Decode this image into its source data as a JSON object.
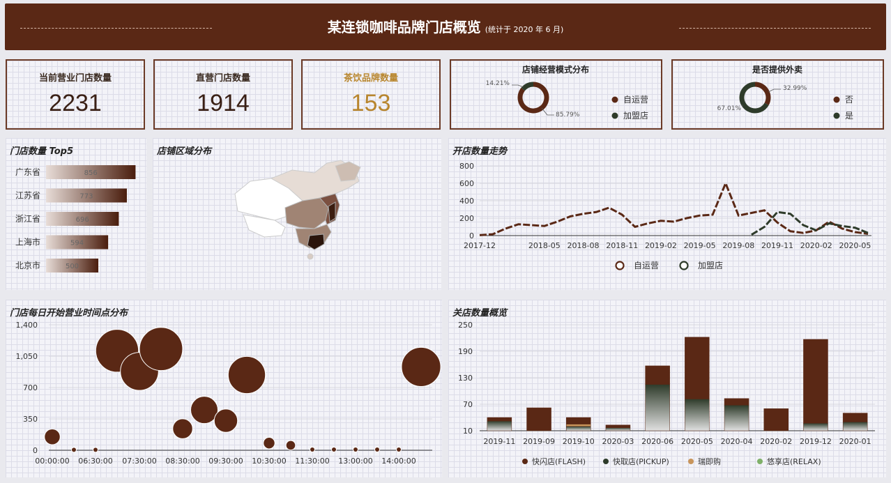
{
  "header": {
    "title": "某连锁咖啡品牌门店概览",
    "subtitle": "(统计于 2020 年 6 月)"
  },
  "kpis": [
    {
      "label": "当前营业门店数量",
      "value": "2231",
      "color": "#3a2015"
    },
    {
      "label": "直营门店数量",
      "value": "1914",
      "color": "#3a2015"
    },
    {
      "label": "茶饮品牌数量",
      "value": "153",
      "color": "#b8862e"
    }
  ],
  "colors": {
    "brown": "#5a2815",
    "green": "#2e3b2a",
    "tan": "#c8955c",
    "lightgreen": "#7fb069"
  },
  "chart_data": [
    {
      "type": "pie",
      "title": "店铺经营模式分布",
      "slices": [
        {
          "name": "自运营",
          "value": 85.79,
          "label": "85.79%"
        },
        {
          "name": "加盟店",
          "value": 14.21,
          "label": "14.21%"
        }
      ]
    },
    {
      "type": "pie",
      "title": "是否提供外卖",
      "slices": [
        {
          "name": "否",
          "value": 32.99,
          "label": "32.99%"
        },
        {
          "name": "是",
          "value": 67.01,
          "label": "67.01%"
        }
      ]
    },
    {
      "type": "bar",
      "title": "门店数量 Top5",
      "categories": [
        "广东省",
        "江苏省",
        "浙江省",
        "上海市",
        "北京市"
      ],
      "values": [
        856,
        773,
        696,
        594,
        500
      ],
      "xlim": [
        0,
        900
      ]
    },
    {
      "type": "map",
      "title": "店铺区域分布"
    },
    {
      "type": "line",
      "title": "开店数量走势",
      "x": [
        "2017-12",
        "2018-01",
        "2018-02",
        "2018-03",
        "2018-04",
        "2018-05",
        "2018-06",
        "2018-07",
        "2018-08",
        "2018-09",
        "2018-10",
        "2018-11",
        "2018-12",
        "2019-01",
        "2019-02",
        "2019-03",
        "2019-04",
        "2019-05",
        "2019-06",
        "2019-07",
        "2019-08",
        "2019-09",
        "2019-10",
        "2019-11",
        "2019-12",
        "2020-01",
        "2020-02",
        "2020-03",
        "2020-04",
        "2020-05",
        "2020-06"
      ],
      "xticks": [
        "2017-12",
        "2018-05",
        "2018-08",
        "2018-11",
        "2019-02",
        "2019-05",
        "2019-08",
        "2019-11",
        "2020-02",
        "2020-05"
      ],
      "ylim": [
        0,
        800
      ],
      "yticks": [
        0,
        200,
        400,
        600,
        800
      ],
      "series": [
        {
          "name": "自运营",
          "values": [
            5,
            15,
            80,
            130,
            120,
            110,
            160,
            220,
            250,
            270,
            320,
            240,
            100,
            140,
            170,
            160,
            200,
            230,
            240,
            600,
            230,
            260,
            290,
            150,
            50,
            30,
            60,
            160,
            80,
            40,
            20
          ]
        },
        {
          "name": "加盟店",
          "values": [
            null,
            null,
            null,
            null,
            null,
            null,
            null,
            null,
            null,
            null,
            null,
            null,
            null,
            null,
            null,
            null,
            null,
            null,
            null,
            null,
            null,
            10,
            100,
            270,
            250,
            120,
            60,
            140,
            110,
            90,
            30
          ]
        }
      ],
      "legend": "bottom"
    },
    {
      "type": "scatter",
      "title": "门店每日开始营业时间点分布",
      "xticks": [
        "00:00:00",
        "06:30:00",
        "07:30:00",
        "08:30:00",
        "09:30:00",
        "10:30:00",
        "11:30:00",
        "13:00:00",
        "14:00:00"
      ],
      "ylim": [
        0,
        1400
      ],
      "yticks": [
        "0",
        "350",
        "700",
        "1,050",
        "1,400"
      ],
      "points": [
        {
          "x": "00:00:00",
          "y": 150
        },
        {
          "x": "06:00:00",
          "y": 5
        },
        {
          "x": "06:30:00",
          "y": 5
        },
        {
          "x": "07:00:00",
          "y": 1110
        },
        {
          "x": "07:15:00",
          "y": 880
        },
        {
          "x": "07:30:00",
          "y": 1130
        },
        {
          "x": "08:30:00",
          "y": 240
        },
        {
          "x": "09:00:00",
          "y": 450
        },
        {
          "x": "09:30:00",
          "y": 330
        },
        {
          "x": "10:00:00",
          "y": 840
        },
        {
          "x": "10:30:00",
          "y": 80
        },
        {
          "x": "11:00:00",
          "y": 55
        },
        {
          "x": "11:30:00",
          "y": 8
        },
        {
          "x": "12:00:00",
          "y": 8
        },
        {
          "x": "13:00:00",
          "y": 8
        },
        {
          "x": "13:30:00",
          "y": 8
        },
        {
          "x": "14:00:00",
          "y": 8
        },
        {
          "x": "15:00:00",
          "y": 930
        }
      ]
    },
    {
      "type": "bar",
      "title": "关店数量概览",
      "stacked": true,
      "categories": [
        "2019-11",
        "2019-09",
        "2019-10",
        "2020-03",
        "2020-06",
        "2020-05",
        "2020-04",
        "2020-02",
        "2019-12",
        "2020-01"
      ],
      "ylim": [
        10,
        250
      ],
      "yticks": [
        10,
        70,
        130,
        190,
        250
      ],
      "series": [
        {
          "name": "快闪店(FLASH)",
          "values": [
            8,
            52,
            15,
            6,
            42,
            140,
            15,
            50,
            190,
            20
          ]
        },
        {
          "name": "快取店(PICKUP)",
          "values": [
            22,
            0,
            10,
            7,
            105,
            72,
            58,
            0,
            17,
            20
          ]
        },
        {
          "name": "瑞即购",
          "values": [
            0,
            0,
            5,
            0,
            0,
            0,
            0,
            0,
            0,
            0
          ]
        },
        {
          "name": "悠享店(RELAX)",
          "values": [
            0,
            0,
            0,
            0,
            0,
            0,
            0,
            0,
            0,
            0
          ]
        }
      ],
      "legend": "bottom"
    }
  ]
}
